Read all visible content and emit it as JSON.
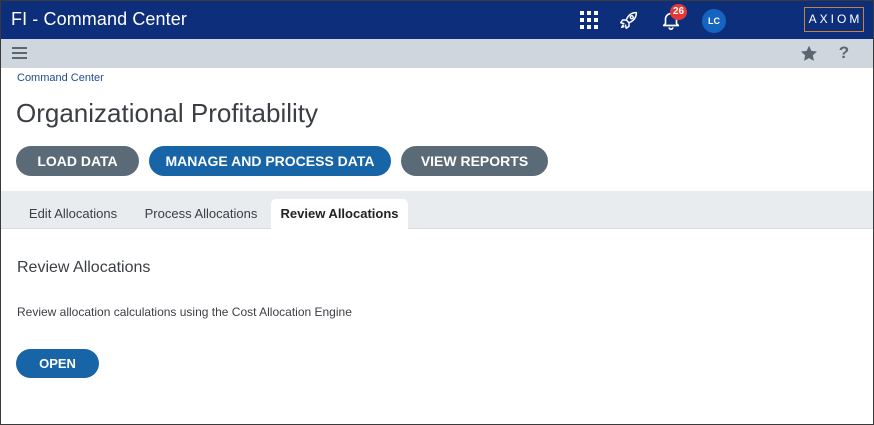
{
  "app": {
    "title": "FI - Command Center"
  },
  "header": {
    "notification_count": "26",
    "avatar_initials": "LC",
    "logo_text": "AXIOM",
    "icons": [
      "apps-grid-icon",
      "rocket-icon",
      "bell-icon"
    ]
  },
  "toolbar": {
    "menu_icon": "hamburger-menu-icon",
    "favorite_icon": "star-icon",
    "help_label": "?"
  },
  "breadcrumb": "Command Center",
  "page_title": "Organizational Profitability",
  "actions": {
    "load": "LOAD DATA",
    "manage": "MANAGE AND PROCESS DATA",
    "reports": "VIEW REPORTS"
  },
  "tabs": [
    {
      "label": "Edit Allocations",
      "active": false
    },
    {
      "label": "Process Allocations",
      "active": false
    },
    {
      "label": "Review Allocations",
      "active": true
    }
  ],
  "section": {
    "title": "Review Allocations",
    "description": "Review allocation calculations using the Cost Allocation Engine",
    "open_label": "OPEN"
  },
  "colors": {
    "header_bg": "#0d2e7a",
    "subbar_bg": "#cfd6de",
    "primary_button": "#1764a7",
    "secondary_button": "#5a6b77",
    "badge": "#e53935",
    "logo_border": "#c8823a"
  }
}
